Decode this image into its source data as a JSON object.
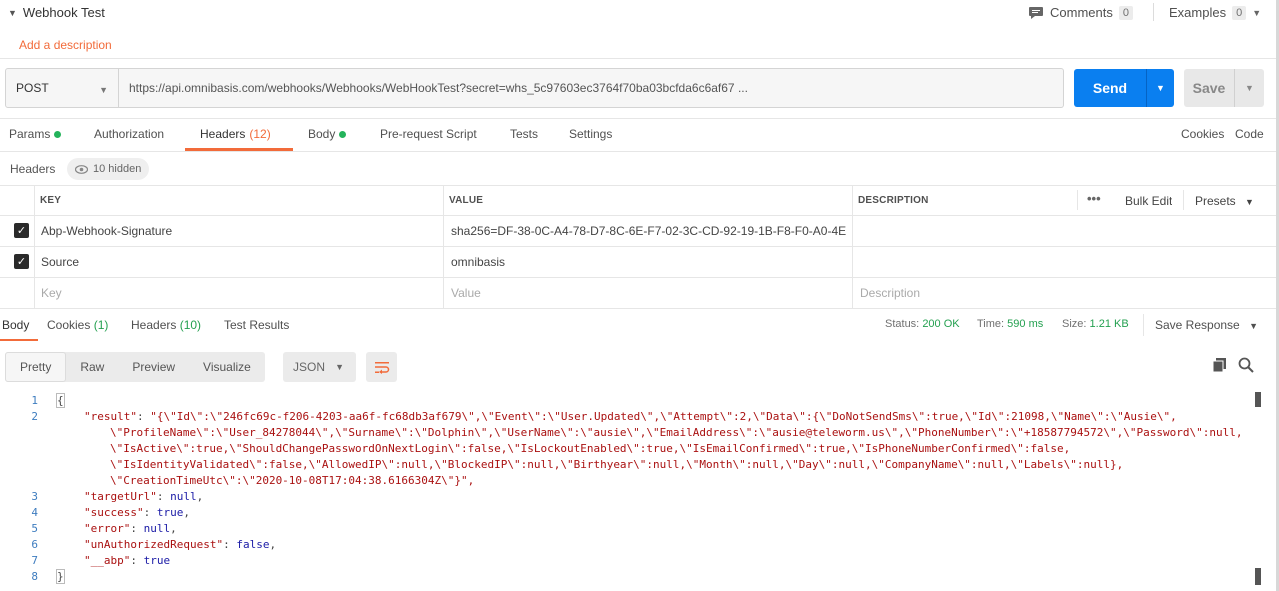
{
  "request": {
    "name": "Webhook Test",
    "add_description": "Add a description",
    "comments_label": "Comments",
    "comments_count": "0",
    "examples_label": "Examples",
    "examples_count": "0",
    "method": "POST",
    "url": "https://api.omnibasis.com/webhooks/Webhooks/WebHookTest?secret=whs_5c97603ec3764f70ba03bcfda6c6af67 ...",
    "send_label": "Send",
    "save_label": "Save"
  },
  "req_tabs": {
    "params": "Params",
    "authorization": "Authorization",
    "headers": "Headers",
    "headers_count": "(12)",
    "body": "Body",
    "prerequest": "Pre-request Script",
    "tests": "Tests",
    "settings": "Settings",
    "cookies": "Cookies",
    "code": "Code"
  },
  "headers": {
    "title": "Headers",
    "hidden": "10 hidden",
    "col_key": "KEY",
    "col_value": "VALUE",
    "col_description": "DESCRIPTION",
    "more": "•••",
    "bulk_edit": "Bulk Edit",
    "presets": "Presets",
    "rows": [
      {
        "key": "Abp-Webhook-Signature",
        "value": "sha256=DF-38-0C-A4-78-D7-8C-6E-F7-02-3C-CD-92-19-1B-F8-F0-A0-4E..."
      },
      {
        "key": "Source",
        "value": "omnibasis"
      }
    ],
    "placeholder_key": "Key",
    "placeholder_value": "Value",
    "placeholder_description": "Description"
  },
  "response": {
    "tab_body": "Body",
    "tab_cookies": "Cookies",
    "tab_cookies_count": "(1)",
    "tab_headers": "Headers",
    "tab_headers_count": "(10)",
    "tab_test_results": "Test Results",
    "status_label": "Status:",
    "status_value": "200 OK",
    "time_label": "Time:",
    "time_value": "590 ms",
    "size_label": "Size:",
    "size_value": "1.21 KB",
    "save_response": "Save Response",
    "view_pretty": "Pretty",
    "view_raw": "Raw",
    "view_preview": "Preview",
    "view_visualize": "Visualize",
    "format": "JSON"
  },
  "code": {
    "line_numbers": [
      "1",
      "2",
      "3",
      "4",
      "5",
      "6",
      "7",
      "8"
    ],
    "result_key": "\"result\"",
    "result_l1": "\"{\\\"Id\\\":\\\"246fc69c-f206-4203-aa6f-fc68db3af679\\\",\\\"Event\\\":\\\"User.Updated\\\",\\\"Attempt\\\":2,\\\"Data\\\":{\\\"DoNotSendSms\\\":true,\\\"Id\\\":21098,\\\"Name\\\":\\\"Ausie\\\",",
    "result_l2": "\\\"ProfileName\\\":\\\"User_84278044\\\",\\\"Surname\\\":\\\"Dolphin\\\",\\\"UserName\\\":\\\"ausie\\\",\\\"EmailAddress\\\":\\\"ausie@teleworm.us\\\",\\\"PhoneNumber\\\":\\\"+18587794572\\\",\\\"Password\\\":null,",
    "result_l3": "\\\"IsActive\\\":true,\\\"ShouldChangePasswordOnNextLogin\\\":false,\\\"IsLockoutEnabled\\\":true,\\\"IsEmailConfirmed\\\":true,\\\"IsPhoneNumberConfirmed\\\":false,",
    "result_l4": "\\\"IsIdentityValidated\\\":false,\\\"AllowedIP\\\":null,\\\"BlockedIP\\\":null,\\\"Birthyear\\\":null,\\\"Month\\\":null,\\\"Day\\\":null,\\\"CompanyName\\\":null,\\\"Labels\\\":null},",
    "result_l5": "\\\"CreationTimeUtc\\\":\\\"2020-10-08T17:04:38.6166304Z\\\"}\",",
    "targetUrl_key": "\"targetUrl\"",
    "targetUrl_val": "null",
    "success_key": "\"success\"",
    "success_val": "true",
    "error_key": "\"error\"",
    "error_val": "null",
    "unauth_key": "\"unAuthorizedRequest\"",
    "unauth_val": "false",
    "abp_key": "\"__abp\"",
    "abp_val": "true"
  },
  "colors": {
    "accent_orange": "#f26b3a",
    "send_blue": "#0a7ff0",
    "status_green": "#24a050"
  }
}
